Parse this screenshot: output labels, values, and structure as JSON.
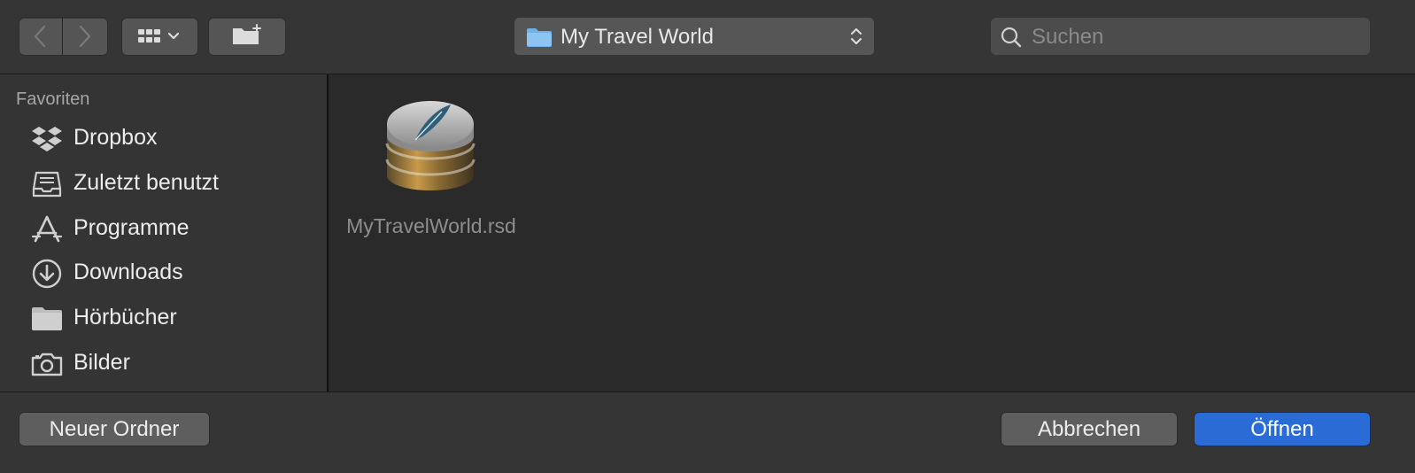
{
  "toolbar": {
    "back_icon": "chevron-left-icon",
    "forward_icon": "chevron-right-icon",
    "view_icon": "grid-view-icon",
    "new_folder_icon": "new-folder-icon",
    "path_popup": {
      "label": "My Travel World",
      "icon": "folder-icon"
    },
    "search": {
      "placeholder": "Suchen",
      "value": ""
    }
  },
  "sidebar": {
    "section_title": "Favoriten",
    "items": [
      {
        "label": "Dropbox",
        "icon": "dropbox-icon"
      },
      {
        "label": "Zuletzt benutzt",
        "icon": "recents-icon"
      },
      {
        "label": "Programme",
        "icon": "applications-icon"
      },
      {
        "label": "Downloads",
        "icon": "downloads-icon"
      },
      {
        "label": "Hörbücher",
        "icon": "folder-icon"
      },
      {
        "label": "Bilder",
        "icon": "camera-icon"
      }
    ]
  },
  "files": [
    {
      "name": "MyTravelWorld.rsd",
      "icon": "database-icon"
    }
  ],
  "footer": {
    "new_folder": "Neuer Ordner",
    "cancel": "Abbrechen",
    "open": "Öffnen"
  },
  "colors": {
    "accent": "#2a6bd6",
    "background": "#2a2a2a"
  }
}
